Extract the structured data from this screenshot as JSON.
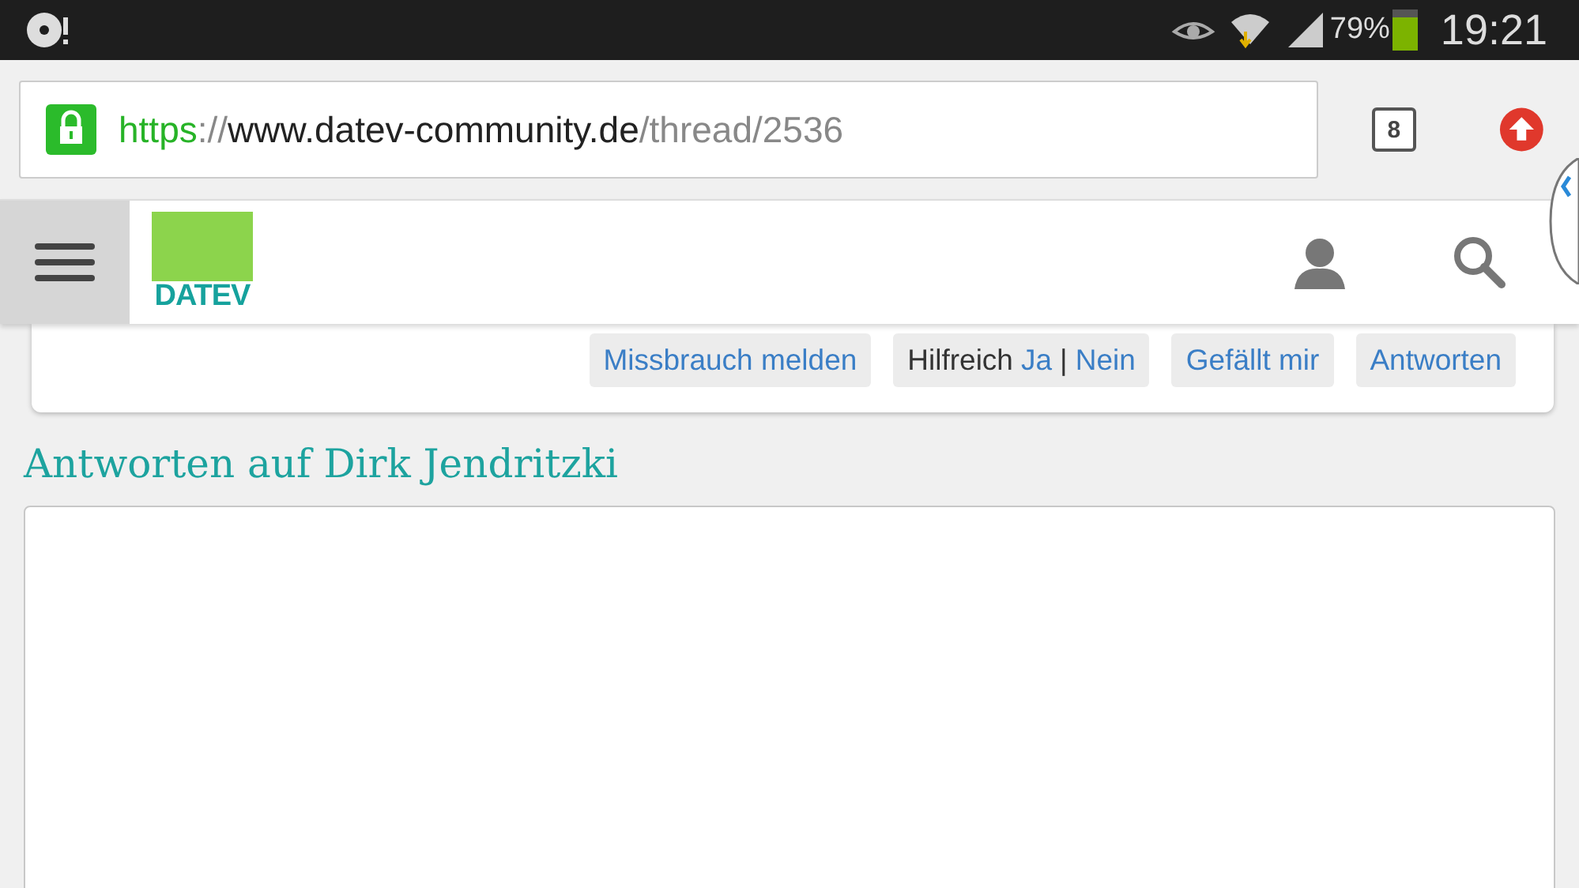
{
  "status_bar": {
    "battery_percent": "79%",
    "battery": {
      "level": 0.79
    },
    "time": "19:21"
  },
  "address_bar": {
    "scheme": "https",
    "separator": "://",
    "host": "www.datev-community.de",
    "path": "/thread/2536"
  },
  "tab_count": "8",
  "site_header": {
    "logo": "DATEV"
  },
  "post_actions": [
    {
      "kind": "link",
      "label": "Missbrauch melden"
    },
    {
      "kind": "helpful",
      "label": "Hilfreich",
      "yes": "Ja",
      "divider": "|",
      "no": "Nein"
    },
    {
      "kind": "link",
      "label": "Gefällt mir"
    },
    {
      "kind": "link",
      "label": "Antworten"
    }
  ],
  "replies": {
    "heading": "Antworten auf Dirk Jendritzki"
  }
}
